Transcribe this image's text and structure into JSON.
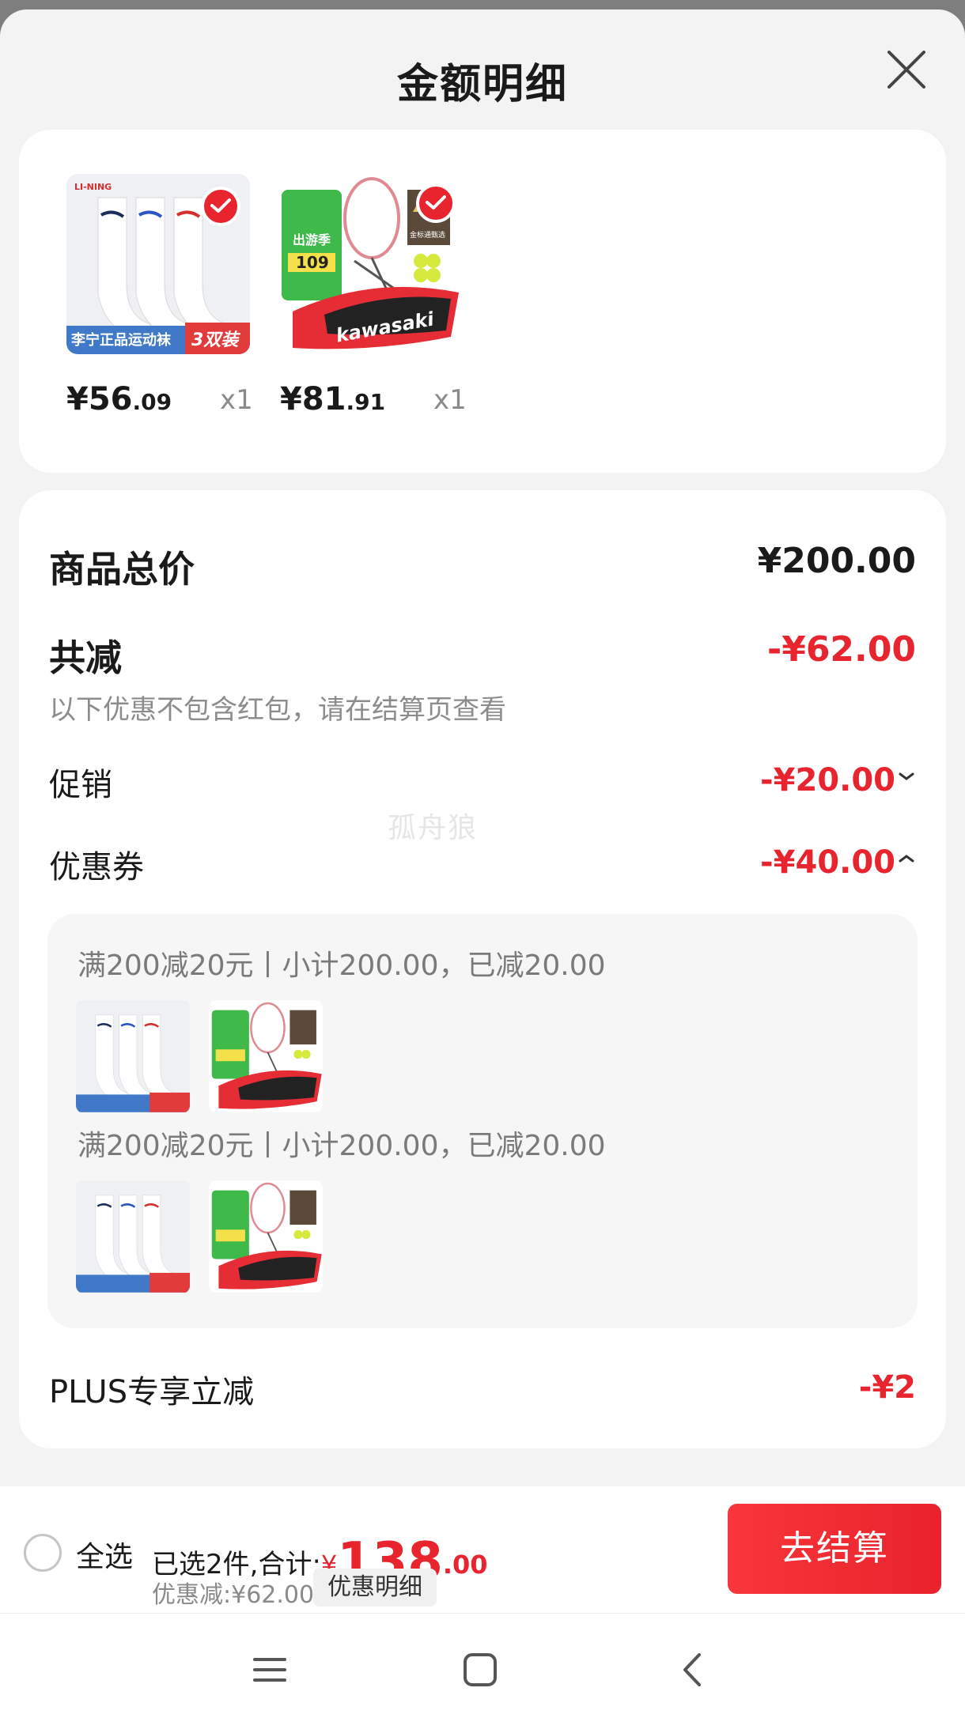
{
  "header": {
    "title": "金额明细"
  },
  "products": [
    {
      "price_int": "¥56",
      "price_dec": ".09",
      "qty": "x1",
      "brand_band": "李宁正品运动袜",
      "pack_badge": "3双装"
    },
    {
      "price_int": "¥81",
      "price_dec": ".91",
      "qty": "x1",
      "brand_band": "kawasaki",
      "promo_tag": "出游季",
      "promo_price": "109",
      "corner_tag": "金标通甄选"
    }
  ],
  "summary": {
    "total_label": "商品总价",
    "total_value": "¥200.00",
    "reduce_label": "共减",
    "reduce_value": "-¥62.00",
    "reduce_note": "以下优惠不包含红包，请在结算页查看",
    "promo_label": "促销",
    "promo_value": "-¥20.00",
    "coupon_label": "优惠券",
    "coupon_value": "-¥40.00",
    "watermark": "孤舟狼",
    "coupons": [
      {
        "text": "满200减20元丨小计200.00，已减20.00"
      },
      {
        "text": "满200减20元丨小计200.00，已减20.00"
      }
    ],
    "plus_label": "PLUS专享立减",
    "plus_value": "-¥2"
  },
  "bottom_bar": {
    "select_all": "全选",
    "selected_text": "已选2件,合计:",
    "yen": "¥",
    "total_int": "138",
    "total_dec": ".00",
    "discount_text": "优惠减:¥62.00",
    "discount_detail": "优惠明细",
    "checkout": "去结算"
  },
  "colors": {
    "accent": "#e8242f",
    "background": "#f3f3f3"
  },
  "nav": {
    "icons": [
      "menu-icon",
      "home-icon",
      "back-icon"
    ]
  }
}
